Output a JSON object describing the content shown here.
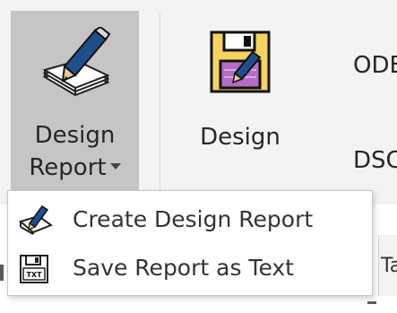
{
  "ribbon": {
    "design_report_button": {
      "label_line1": "Design",
      "label_line2": "Report",
      "icon": "notepad-pencil-icon"
    },
    "design_button": {
      "label": "Design",
      "icon": "floppy-disk-pencil-icon"
    },
    "side_labels": {
      "top": "ODB",
      "bottom": "DSC"
    }
  },
  "dropdown_menu": {
    "items": [
      {
        "label": "Create Design Report",
        "icon": "pencil-edit-icon"
      },
      {
        "label": "Save Report as Text",
        "icon": "save-txt-icon"
      }
    ]
  },
  "edge_fragment": "Ta",
  "colors": {
    "ribbon_background": "#f3f3f3",
    "active_button": "#c5c5c5",
    "menu_background": "#ffffff",
    "pencil_blue": "#1f4e8c",
    "floppy_yellow": "#f4d35e",
    "floppy_purple": "#b56cc4"
  }
}
